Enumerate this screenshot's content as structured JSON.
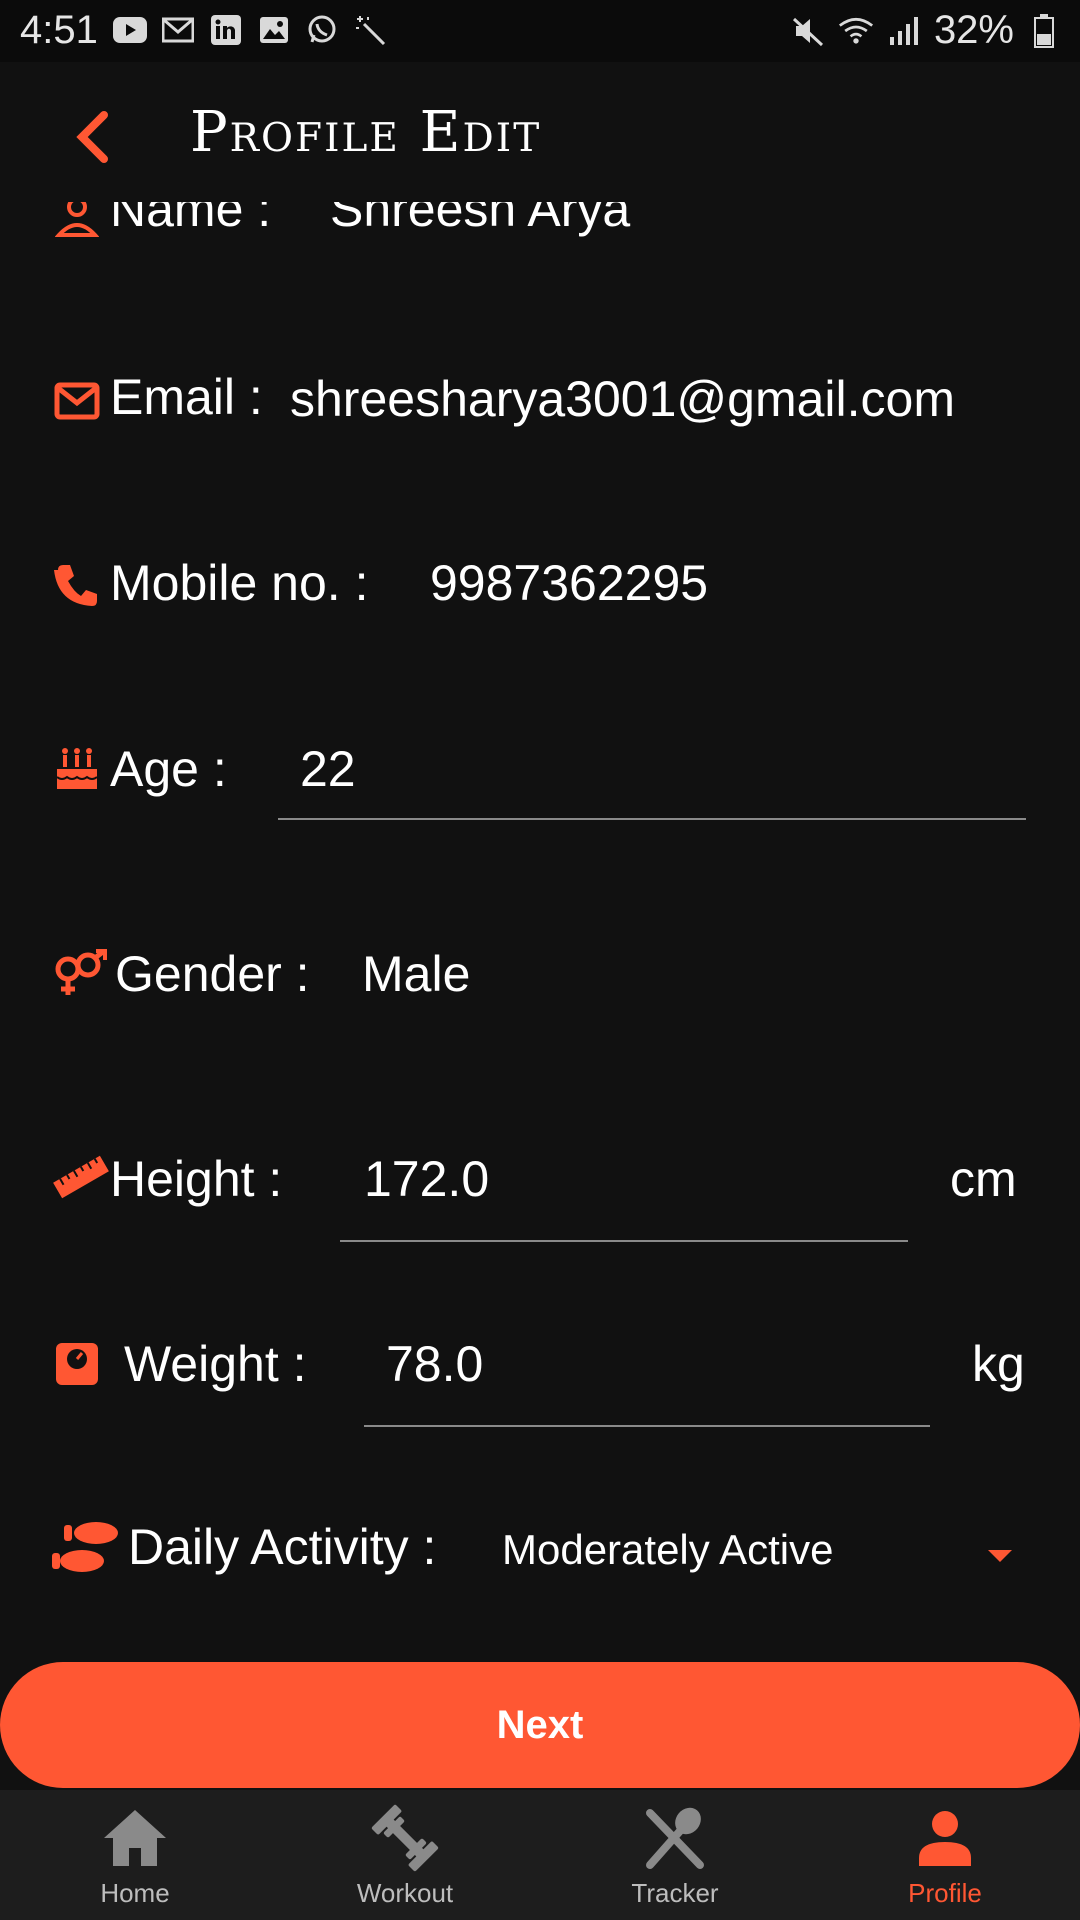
{
  "status_bar": {
    "time": "4:51",
    "battery": "32%",
    "left_icons": [
      "youtube-icon",
      "gmail-icon",
      "linkedin-icon",
      "gallery-icon",
      "whatsapp-icon",
      "magic-wand-icon"
    ],
    "right_icons": [
      "mute-icon",
      "wifi-icon",
      "signal-icon",
      "battery-icon"
    ]
  },
  "header": {
    "title": "Profile Edit",
    "back_icon": "chevron-left-icon"
  },
  "form": {
    "name": {
      "label": "Name :",
      "value": "Shreesh Arya"
    },
    "email": {
      "label": "Email :",
      "value": "shreesharya3001@gmail.com"
    },
    "mobile": {
      "label": "Mobile no. :",
      "value": "9987362295"
    },
    "age": {
      "label": "Age :",
      "value": "22"
    },
    "gender": {
      "label": "Gender :",
      "value": "Male"
    },
    "height": {
      "label": "Height :",
      "value": "172.0",
      "unit": "cm"
    },
    "weight": {
      "label": "Weight :",
      "value": "78.0",
      "unit": "kg"
    },
    "activity": {
      "label": "Daily Activity :",
      "value": "Moderately Active"
    }
  },
  "next_label": "Next",
  "nav": [
    {
      "label": "Home",
      "icon": "home-icon",
      "active": false
    },
    {
      "label": "Workout",
      "icon": "dumbbell-icon",
      "active": false
    },
    {
      "label": "Tracker",
      "icon": "utensils-icon",
      "active": false
    },
    {
      "label": "Profile",
      "icon": "person-icon",
      "active": true
    }
  ],
  "colors": {
    "accent": "#ff5733",
    "background": "#111111",
    "nav_bg": "#1d1d1d"
  }
}
